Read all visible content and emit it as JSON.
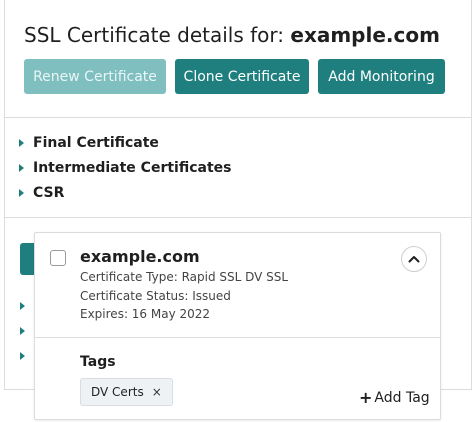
{
  "header": {
    "title_prefix": "SSL Certificate details for:",
    "title_domain": "example.com"
  },
  "toolbar": {
    "renew_label": "Renew Certificate",
    "clone_label": "Clone Certificate",
    "monitor_label": "Add Monitoring"
  },
  "accordion": {
    "items": [
      {
        "label": "Final Certificate"
      },
      {
        "label": "Intermediate Certificates"
      },
      {
        "label": "CSR"
      }
    ]
  },
  "card": {
    "domain": "example.com",
    "certificate_type": "Certificate Type: Rapid SSL DV SSL",
    "certificate_status": "Certificate Status: Issued",
    "expires": "Expires: 16 May 2022",
    "tags_label": "Tags",
    "tags": [
      {
        "label": "DV Certs",
        "remove": "×"
      }
    ],
    "add_tag_label": "Add Tag",
    "add_tag_icon": "+"
  },
  "colors": {
    "accent": "#1f7f7f",
    "accent_disabled": "#7fbfbf",
    "border": "#dcdcdc",
    "tag_bg": "#eef2f5"
  }
}
